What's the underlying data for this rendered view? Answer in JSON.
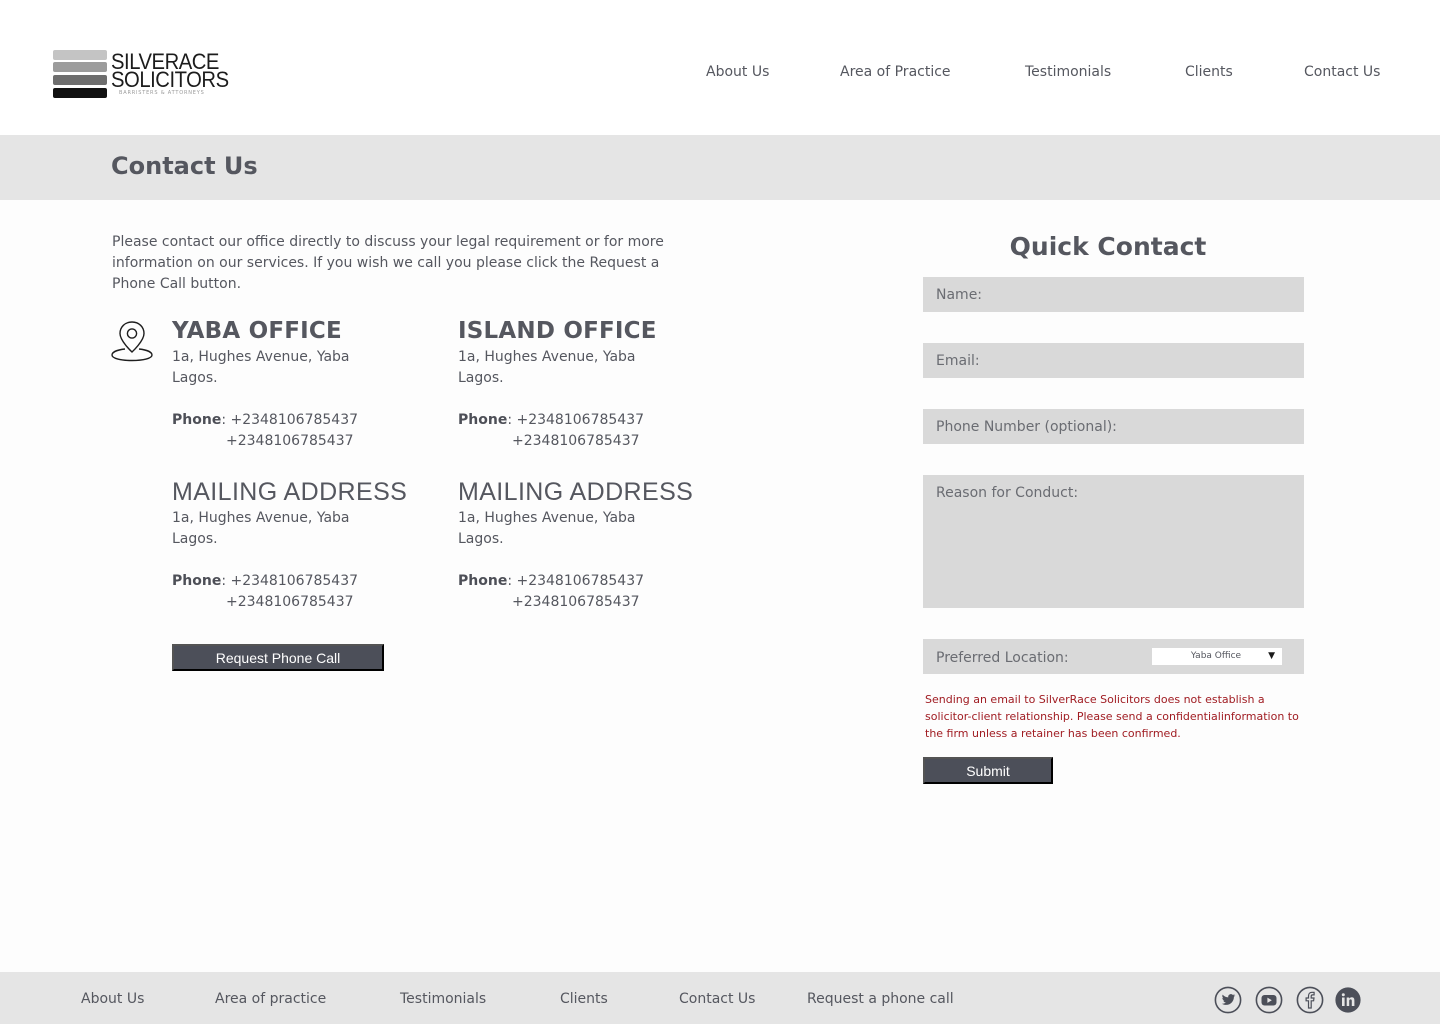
{
  "brand": {
    "line1": "SILVERACE",
    "line2": "SOLICITORS",
    "tagline": "BARRISTERS & ATTORNEYS"
  },
  "nav": {
    "about": "About Us",
    "practice": "Area of Practice",
    "testimonials": "Testimonials",
    "clients": "Clients",
    "contact": "Contact Us"
  },
  "page_title": "Contact Us",
  "intro": "Please contact our office directly to discuss your legal requirement  or for more information on our services. If you wish we call you please click the Request a Phone Call button.",
  "offices": [
    {
      "title": "YABA OFFICE",
      "address": "1a, Hughes Avenue, Yaba\nLagos.",
      "phone_label": "Phone",
      "phone1": "+2348106785437",
      "phone2": "+2348106785437"
    },
    {
      "title": "ISLAND OFFICE",
      "address": "1a, Hughes Avenue, Yaba\nLagos.",
      "phone_label": "Phone",
      "phone1": "+2348106785437",
      "phone2": "+2348106785437"
    },
    {
      "title": "MAILING ADDRESS",
      "address": "1a, Hughes Avenue, Yaba\nLagos.",
      "phone_label": "Phone",
      "phone1": "+2348106785437",
      "phone2": "+2348106785437"
    },
    {
      "title": "MAILING ADDRESS",
      "address": "1a, Hughes Avenue, Yaba\nLagos.",
      "phone_label": "Phone",
      "phone1": "+2348106785437",
      "phone2": "+2348106785437"
    }
  ],
  "request_button": "Request Phone Call",
  "quick_contact": {
    "title": "Quick Contact",
    "name_placeholder": "Name:",
    "email_placeholder": "Email:",
    "phone_placeholder": "Phone Number (optional):",
    "reason_placeholder": "Reason for Conduct:",
    "location_label": "Preferred Location:",
    "location_value": "Yaba Office",
    "disclaimer": "Sending an email to SilverRace Solicitors does not establish a solicitor-client relationship. Please send a confidentialinformation to the firm unless a retainer has been confirmed.",
    "submit": "Submit"
  },
  "footer": {
    "about": "About Us",
    "practice": "Area of practice",
    "testimonials": "Testimonials",
    "clients": "Clients",
    "contact": "Contact Us",
    "request": "Request a phone call"
  },
  "social_icons": [
    "twitter-icon",
    "youtube-icon",
    "facebook-icon",
    "linkedin-icon"
  ],
  "colors": {
    "accent_dark": "#4c4f59",
    "text": "#55575f",
    "band": "#e5e5e5",
    "field": "#d9d9d9",
    "warning": "#a01c22"
  }
}
